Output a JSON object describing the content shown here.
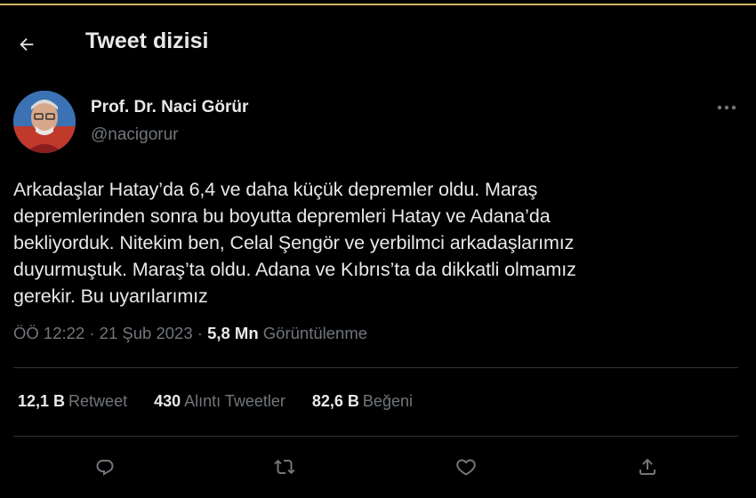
{
  "header": {
    "title": "Tweet dizisi"
  },
  "author": {
    "name": "Prof. Dr. Naci Görür",
    "handle": "@nacigorur"
  },
  "tweet": {
    "lines": [
      "Arkadaşlar Hatay’da 6,4 ve daha küçük depremler oldu. Maraş",
      "depremlerinden sonra bu boyutta depremleri Hatay ve Adana’da",
      "bekliyorduk. Nitekim ben, Celal Şengör ve yerbilmci arkadaşlarımız",
      "duyurmuştuk. Maraş’ta oldu. Adana ve Kıbrıs’ta da dikkatli olmamız",
      "gerekir. Bu uyarılarımız"
    ]
  },
  "meta": {
    "time": "ÖÖ 12:22",
    "separator": " · ",
    "date": "21 Şub 2023",
    "views_count": "5,8 Mn",
    "views_label": "Görüntülenme"
  },
  "stats": {
    "retweets": {
      "count": "12,1 B",
      "label": "Retweet"
    },
    "quotes": {
      "count": "430",
      "label": "Alıntı Tweetler"
    },
    "likes": {
      "count": "82,6 B",
      "label": "Beğeni"
    }
  },
  "icons": {
    "back": "arrow-left-icon",
    "more": "more-dots-icon",
    "reply": "reply-icon",
    "retweet": "retweet-icon",
    "like": "heart-icon",
    "share": "share-icon"
  },
  "colors": {
    "background": "#000000",
    "text": "#e7e9ea",
    "muted": "#71767b",
    "divider": "#2f3336",
    "top_accent": "#d4b46a"
  }
}
